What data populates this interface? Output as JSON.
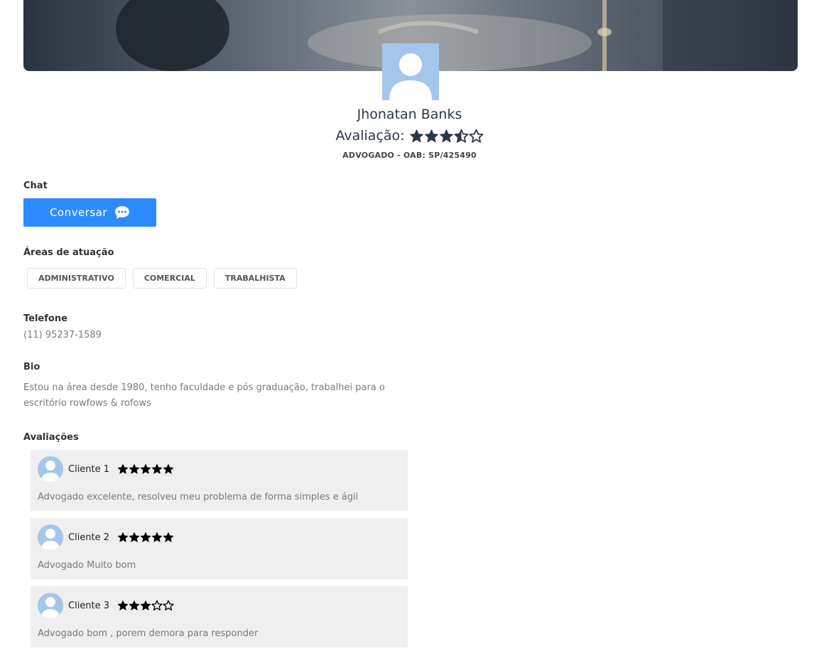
{
  "profile": {
    "name": "Jhonatan Banks",
    "rating_label": "Avaliação:",
    "rating_value": 3.5,
    "profession": "ADVOGADO - OAB: SP/425490"
  },
  "chat": {
    "label": "Chat",
    "button_label": "Conversar"
  },
  "areas": {
    "label": "Áreas de atuação",
    "items": [
      "ADMINISTRATIVO",
      "COMERCIAL",
      "TRABALHISTA"
    ]
  },
  "phone": {
    "label": "Telefone",
    "value": "(11) 95237-1589"
  },
  "bio": {
    "label": "Bio",
    "text": "Estou na área desde 1980, tenho faculdade e pós graduação, trabalhei para o escritório rowfows & rofows"
  },
  "reviews": {
    "label": "Avaliações",
    "items": [
      {
        "name": "Cliente 1",
        "rating": 5,
        "text": "Advogado excelente, resolveu meu problema de forma simples e ágil"
      },
      {
        "name": "Cliente 2",
        "rating": 5,
        "text": "Advogado Muito bom"
      },
      {
        "name": "Cliente 3",
        "rating": 3,
        "text": "Advogado bom , porem demora para responder"
      }
    ]
  },
  "colors": {
    "primary_button": "#2e8bff",
    "avatar_bg": "#a4c6ea",
    "review_bg": "#efefef"
  }
}
